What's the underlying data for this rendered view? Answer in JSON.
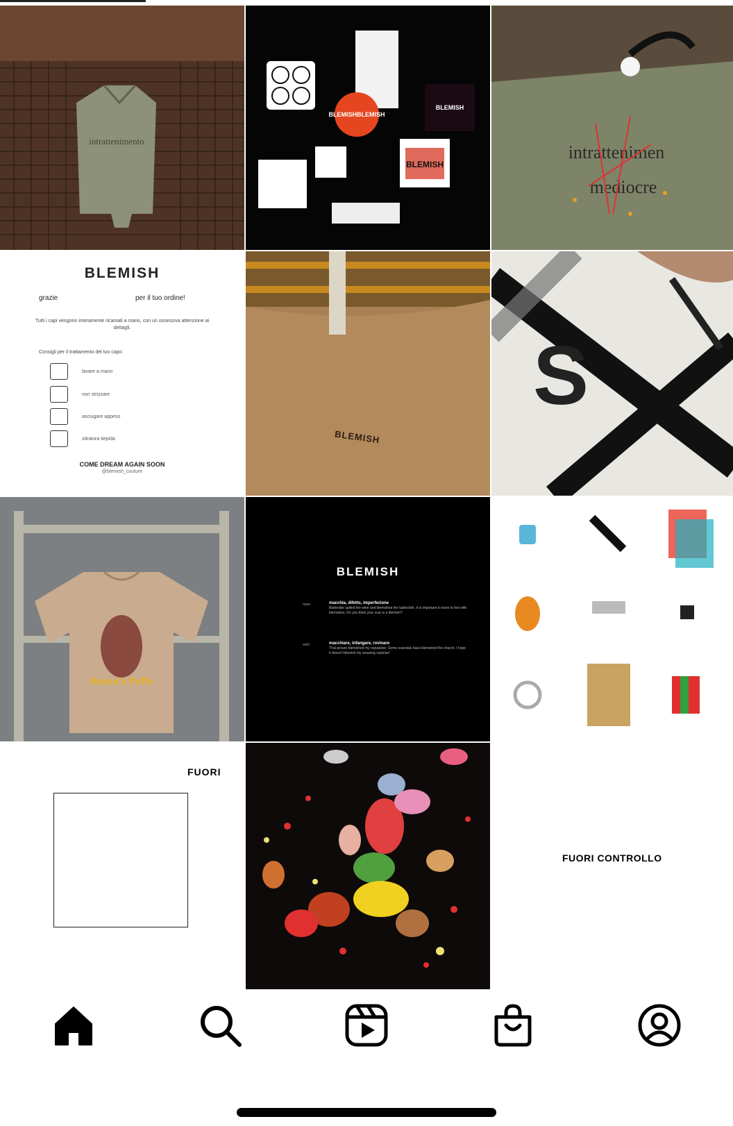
{
  "grid": {
    "card": {
      "brand": "BLEMISH",
      "thanks_left": "grazie",
      "thanks_right": "per il tuo ordine!",
      "description": "Tutti i capi vengono interamente ricamati a mano, con un ossessiva attenzione ai dettagli.",
      "tips_title": "Consigli per il trattamento del tuo capo:",
      "care": [
        {
          "label": "lavare a mano"
        },
        {
          "label": "non strizzare"
        },
        {
          "label": "asciugare appeso"
        },
        {
          "label": "stiratura tiepida"
        }
      ],
      "signoff": "COME DREAM AGAIN SOON",
      "handle": "@blemish_couture"
    },
    "stickers": {
      "badge_text": "BLEMISHBLEMISH",
      "label_small": "BLEMISH",
      "label_gradient": "BLEMISH"
    },
    "jacket_embroidery": "intrattenimento mediocre",
    "bag": {
      "brand": "BLEMISH"
    },
    "tshirt_graphic": "Reese's Puffs",
    "definition": {
      "title": "BLEMISH",
      "noun": {
        "pos": "noun",
        "meaning": "macchia, difetto, imperfezione",
        "example": "Bartender spilled the wine and blemished the tablecloth. It is important to learn to live with blemishes. Do you think your scar is a blemish?"
      },
      "verb": {
        "pos": "verb",
        "meaning": "macchiare, infangare, rovinare",
        "example": "That picture blemished my reputation. Some scandals have blemished the church. I hope it doesn't blemish my amazing surprise!"
      }
    },
    "fuori": {
      "label": "FUORI"
    },
    "fuori_controllo": {
      "label": "FUORI CONTROLLO"
    }
  },
  "nav": {
    "items": [
      {
        "icon": "home-icon",
        "active": true
      },
      {
        "icon": "search-icon"
      },
      {
        "icon": "reels-icon"
      },
      {
        "icon": "shop-icon"
      },
      {
        "icon": "profile-icon"
      }
    ]
  }
}
